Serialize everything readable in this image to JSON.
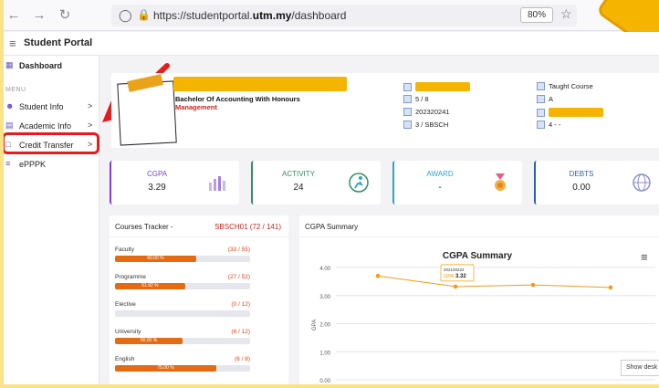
{
  "browser": {
    "url_prefix": "https://studentportal.",
    "url_domain": "utm.my",
    "url_suffix": "/dashboard",
    "zoom": "80%"
  },
  "app": {
    "title": "Student Portal"
  },
  "sidebar": {
    "dashboard": "Dashboard",
    "menu_header": "MENU",
    "items": [
      {
        "label": "Student Info",
        "chevron": ">"
      },
      {
        "label": "Academic Info",
        "chevron": ">"
      },
      {
        "label": "Credit Transfer",
        "chevron": ">"
      },
      {
        "label": "ePPPK",
        "chevron": ""
      }
    ]
  },
  "profile": {
    "programme": "Bachelor Of Accounting With Honours",
    "faculty": "Management",
    "semester": "5 / 8",
    "session": "202320241",
    "status": "3 / SBSCH",
    "taught_course": "Taught Course",
    "grade": "A",
    "extra": "4 - -"
  },
  "stats": [
    {
      "title": "CGPA",
      "value": "3.29",
      "color": "#7d3fd8"
    },
    {
      "title": "ACTIVITY",
      "value": "24",
      "color": "#2f8f60"
    },
    {
      "title": "AWARD",
      "value": "-",
      "color": "#2aa5c9"
    },
    {
      "title": "DEBTS",
      "value": "0.00",
      "color": "#2c5fb5"
    }
  ],
  "tracker": {
    "title": "Courses Tracker -",
    "code": "SBSCH01 (72 / 141)",
    "rows": [
      {
        "label": "Faculty",
        "count": "(33 / 55)",
        "pct": "60.00 %",
        "value": 60.0
      },
      {
        "label": "Programme",
        "count": "(27 / 52)",
        "pct": "51.92 %",
        "value": 51.92
      },
      {
        "label": "Elective",
        "count": "(0 / 12)",
        "pct": "",
        "value": 0
      },
      {
        "label": "University",
        "count": "(6 / 12)",
        "pct": "50.00 %",
        "value": 50.0
      },
      {
        "label": "English",
        "count": "(6 / 8)",
        "pct": "75.00 %",
        "value": 75.0
      }
    ]
  },
  "cgpa_panel": {
    "title": "CGPA Summary",
    "menu_icon": "≡"
  },
  "tooltip": {
    "session": "202120222",
    "label": "GPA:",
    "value": "3.32"
  },
  "show_desktop": "Show desk",
  "chart_data": {
    "type": "line",
    "title": "CGPA Summary",
    "ylabel": "GPA",
    "ylim": [
      0,
      4
    ],
    "yticks": [
      "0.00",
      "1.00",
      "2.00",
      "3.00",
      "4.00"
    ],
    "series": [
      {
        "values": [
          3.7,
          3.32,
          3.38,
          3.29
        ]
      }
    ],
    "color": "#f39c12"
  }
}
